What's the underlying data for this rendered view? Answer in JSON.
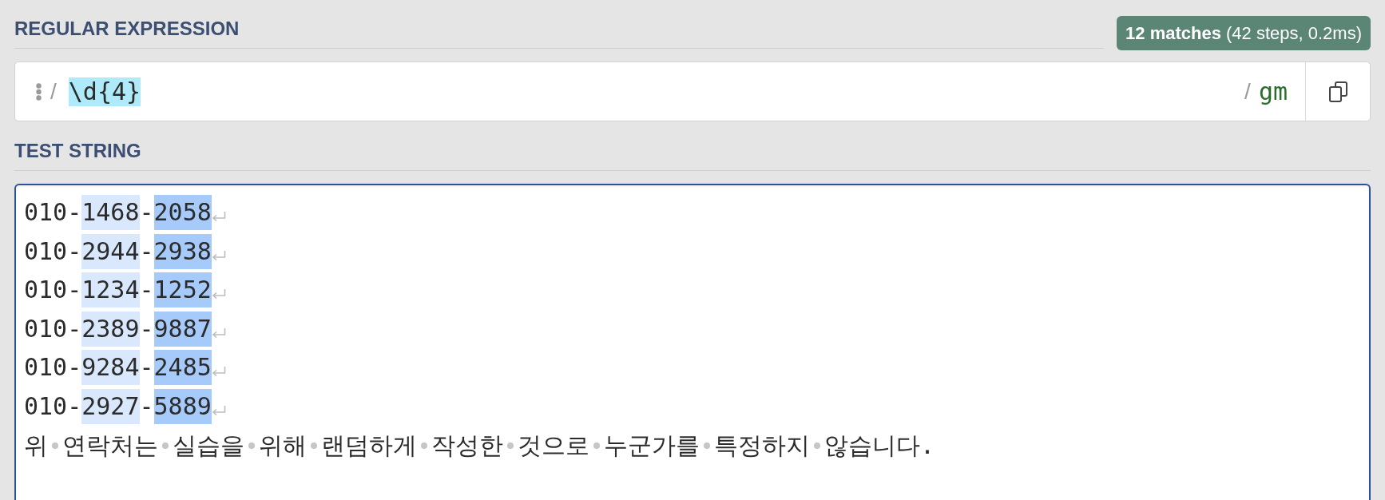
{
  "regex": {
    "label": "REGULAR EXPRESSION",
    "match_summary": "**12 matches** (42 steps, 0.2ms)",
    "open_delimiter": "/",
    "pattern": "\\d{4}",
    "close_delimiter": "/",
    "flags": "gm"
  },
  "test_string": {
    "label": "TEST STRING",
    "show_whitespace": true,
    "lines": [
      {
        "segments": [
          {
            "kind": "text",
            "text": "010-"
          },
          {
            "kind": "match",
            "text": "1468",
            "color": "#d9e8fc"
          },
          {
            "kind": "text",
            "text": "-"
          },
          {
            "kind": "match",
            "text": "2058",
            "color": "#a6cbfa"
          },
          {
            "kind": "newline"
          }
        ]
      },
      {
        "segments": [
          {
            "kind": "text",
            "text": "010-"
          },
          {
            "kind": "match",
            "text": "2944",
            "color": "#d9e8fc"
          },
          {
            "kind": "text",
            "text": "-"
          },
          {
            "kind": "match",
            "text": "2938",
            "color": "#a6cbfa"
          },
          {
            "kind": "newline"
          }
        ]
      },
      {
        "segments": [
          {
            "kind": "text",
            "text": "010-"
          },
          {
            "kind": "match",
            "text": "1234",
            "color": "#d9e8fc"
          },
          {
            "kind": "text",
            "text": "-"
          },
          {
            "kind": "match",
            "text": "1252",
            "color": "#a6cbfa"
          },
          {
            "kind": "newline"
          }
        ]
      },
      {
        "segments": [
          {
            "kind": "text",
            "text": "010-"
          },
          {
            "kind": "match",
            "text": "2389",
            "color": "#d9e8fc"
          },
          {
            "kind": "text",
            "text": "-"
          },
          {
            "kind": "match",
            "text": "9887",
            "color": "#a6cbfa"
          },
          {
            "kind": "newline"
          }
        ]
      },
      {
        "segments": [
          {
            "kind": "text",
            "text": "010-"
          },
          {
            "kind": "match",
            "text": "9284",
            "color": "#d9e8fc"
          },
          {
            "kind": "text",
            "text": "-"
          },
          {
            "kind": "match",
            "text": "2485",
            "color": "#a6cbfa"
          },
          {
            "kind": "newline"
          }
        ]
      },
      {
        "segments": [
          {
            "kind": "text",
            "text": "010-"
          },
          {
            "kind": "match",
            "text": "2927",
            "color": "#d9e8fc"
          },
          {
            "kind": "text",
            "text": "-"
          },
          {
            "kind": "match",
            "text": "5889",
            "color": "#a6cbfa"
          },
          {
            "kind": "newline"
          }
        ]
      },
      {
        "segments": [
          {
            "kind": "text",
            "text": "위"
          },
          {
            "kind": "space"
          },
          {
            "kind": "text",
            "text": "연락처는"
          },
          {
            "kind": "space"
          },
          {
            "kind": "text",
            "text": "실습을"
          },
          {
            "kind": "space"
          },
          {
            "kind": "text",
            "text": "위해"
          },
          {
            "kind": "space"
          },
          {
            "kind": "text",
            "text": "랜덤하게"
          },
          {
            "kind": "space"
          },
          {
            "kind": "text",
            "text": "작성한"
          },
          {
            "kind": "space"
          },
          {
            "kind": "text",
            "text": "것으로"
          },
          {
            "kind": "space"
          },
          {
            "kind": "text",
            "text": "누군가를"
          },
          {
            "kind": "space"
          },
          {
            "kind": "text",
            "text": "특정하지"
          },
          {
            "kind": "space"
          },
          {
            "kind": "text",
            "text": "않습니다."
          }
        ]
      }
    ]
  }
}
